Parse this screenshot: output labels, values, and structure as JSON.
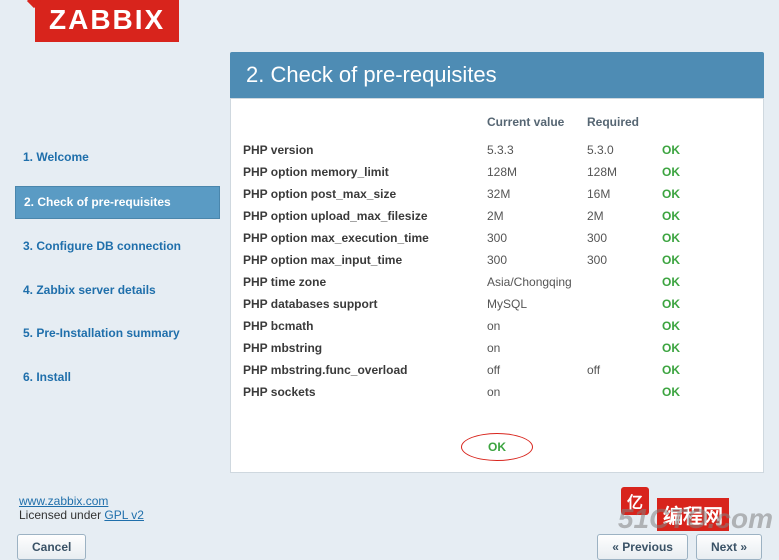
{
  "logo": "ZABBIX",
  "sidebar": {
    "items": [
      {
        "label": "1. Welcome"
      },
      {
        "label": "2. Check of pre-requisites"
      },
      {
        "label": "3. Configure DB connection"
      },
      {
        "label": "4. Zabbix server details"
      },
      {
        "label": "5. Pre-Installation summary"
      },
      {
        "label": "6. Install"
      }
    ]
  },
  "step_title": "2. Check of pre-requisites",
  "columns": {
    "current": "Current value",
    "required": "Required"
  },
  "checks": [
    {
      "name": "PHP version",
      "current": "5.3.3",
      "required": "5.3.0",
      "status": "OK"
    },
    {
      "name": "PHP option memory_limit",
      "current": "128M",
      "required": "128M",
      "status": "OK"
    },
    {
      "name": "PHP option post_max_size",
      "current": "32M",
      "required": "16M",
      "status": "OK"
    },
    {
      "name": "PHP option upload_max_filesize",
      "current": "2M",
      "required": "2M",
      "status": "OK"
    },
    {
      "name": "PHP option max_execution_time",
      "current": "300",
      "required": "300",
      "status": "OK"
    },
    {
      "name": "PHP option max_input_time",
      "current": "300",
      "required": "300",
      "status": "OK"
    },
    {
      "name": "PHP time zone",
      "current": "Asia/Chongqing",
      "required": "",
      "status": "OK"
    },
    {
      "name": "PHP databases support",
      "current": "MySQL",
      "required": "",
      "status": "OK"
    },
    {
      "name": "PHP bcmath",
      "current": "on",
      "required": "",
      "status": "OK"
    },
    {
      "name": "PHP mbstring",
      "current": "on",
      "required": "",
      "status": "OK"
    },
    {
      "name": "PHP mbstring.func_overload",
      "current": "off",
      "required": "off",
      "status": "OK"
    },
    {
      "name": "PHP sockets",
      "current": "on",
      "required": "",
      "status": "OK"
    }
  ],
  "summary_status": "OK",
  "footer": {
    "link_label": "www.zabbix.com",
    "license_prefix": "Licensed under ",
    "license_link": "GPL v2"
  },
  "buttons": {
    "cancel": "Cancel",
    "previous": "« Previous",
    "next": "Next »"
  },
  "watermarks": {
    "w1": "51CTO.com",
    "w2": "编程网",
    "w3": "亿"
  }
}
